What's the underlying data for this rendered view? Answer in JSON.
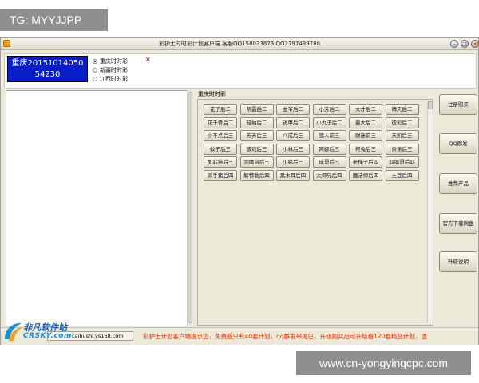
{
  "overlay": {
    "tg_label": "TG: MYYJJPP",
    "watermark_url": "www.cn-yongyingcpc.com"
  },
  "window": {
    "title": "彩护士时时彩计划客户端  客服QQ158023673    QQ2797439788",
    "controls": [
      "minimize",
      "maximize",
      "close"
    ]
  },
  "top": {
    "lottery_line1": "重庆20151014050",
    "lottery_line2": "54230",
    "regions": [
      {
        "label": "重庆时时彩",
        "selected": true
      },
      {
        "label": "新疆时时彩",
        "selected": false
      },
      {
        "label": "江西时时彩",
        "selected": false
      }
    ],
    "close_glyph": "×"
  },
  "plans": {
    "group_label": "重庆时时彩",
    "buttons": [
      "花子后二",
      "帮霸后二",
      "龙爷后二",
      "小芳后二",
      "大才后二",
      "晴天后二",
      "花千骨后二",
      "轻纳后二",
      "锐甲后二",
      "小丸子后二",
      "最大后二",
      "彼彩后二",
      "小不点后三",
      "芳芳后三",
      "八戒后三",
      "猪人前三",
      "财迷前三",
      "天凯后三",
      "蚊子后三",
      "该戏后三",
      "小林后三",
      "阿娜后三",
      "帮兔后三",
      "亲亲后三",
      "加菲猫后三",
      "剑魔前后三",
      "小猪后三",
      "成哥后三",
      "老梯子后四",
      "四郎哥后四",
      "杀手猪后四",
      "解特勒后四",
      "黑木耳后四",
      "大师兄后四",
      "魔法师后四",
      "土豆后四"
    ]
  },
  "side": {
    "buttons": [
      "注册购买",
      "QQ群发",
      "推荐产品",
      "官方下载网盘",
      "升级说明"
    ]
  },
  "status": {
    "url": "caihushi.ys168.com",
    "ticker": "彩护士计划客户端提示您，免费版只有40套计划，qq群发带尾巴，升级购买后可升级看120套精品计划，透"
  },
  "logo": {
    "text1": "非凡软件站",
    "text2": "CRSKY.com"
  },
  "colors": {
    "lottery_bg": "#0a1ec8",
    "ticker": "#e03000",
    "window_bg": "#ece9d8"
  }
}
